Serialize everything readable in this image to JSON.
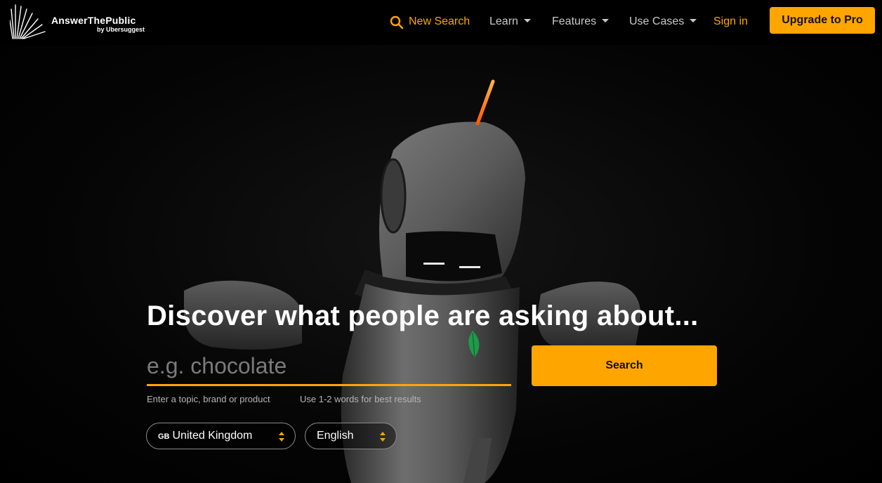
{
  "brand": {
    "name": "AnswerThePublic",
    "byline": "by Ubersuggest"
  },
  "nav": {
    "new_search": "New Search",
    "learn": "Learn",
    "features": "Features",
    "use_cases": "Use Cases",
    "sign_in": "Sign in",
    "upgrade": "Upgrade to Pro"
  },
  "hero": {
    "headline": "Discover what people are asking about...",
    "search_placeholder": "e.g. chocolate",
    "search_value": "",
    "search_button": "Search",
    "hint_topic": "Enter a topic, brand or product",
    "hint_words": "Use 1-2 words for best results",
    "country": {
      "code": "GB",
      "label": "United Kingdom"
    },
    "language": "English"
  },
  "icons": {
    "logo": "starburst-logo-icon",
    "search": "search-icon",
    "caret": "caret-down-icon",
    "select_arrows": "sort-arrows-icon"
  },
  "colors": {
    "accent": "#ffa500",
    "background": "#000000",
    "nav_text": "#c9c9c9"
  }
}
